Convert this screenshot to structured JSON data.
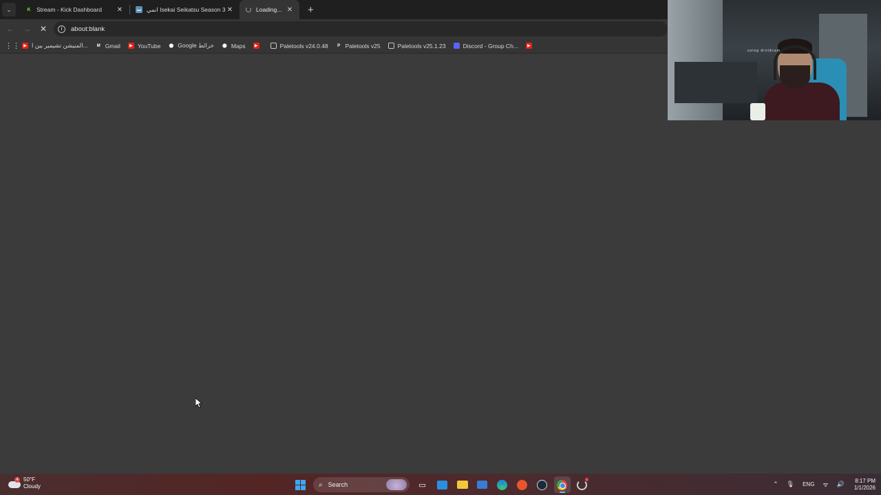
{
  "browser": {
    "tab_search_glyph": "⌄",
    "tabs": [
      {
        "title": "Stream - Kick Dashboard",
        "favicon": "kick-icon"
      },
      {
        "title": "انمي Isekai Seikatsu Season 3 ...",
        "favicon": "anime-site-icon"
      },
      {
        "title": "Loading...",
        "favicon": "loading-spinner-icon"
      }
    ],
    "close_glyph": "✕",
    "new_tab_glyph": "+",
    "back_glyph": "←",
    "forward_glyph": "→",
    "stop_glyph": "✕",
    "info_glyph": "i",
    "address": "about:blank",
    "apps_glyph": "⋮⋮",
    "bookmarks": [
      {
        "label": "المنيشن تشيمير بين ا...",
        "icon": "youtube-icon"
      },
      {
        "label": "Gmail",
        "icon": "gmail-icon"
      },
      {
        "label": "YouTube",
        "icon": "youtube-icon"
      },
      {
        "label": "Google خرائط",
        "icon": "maps-icon"
      },
      {
        "label": "Maps",
        "icon": "maps-icon"
      },
      {
        "label": "",
        "icon": "youtube-icon"
      },
      {
        "label": "Paletools v24.0.48",
        "icon": "globe-icon"
      },
      {
        "label": "Paletools v25",
        "icon": "paletools-icon"
      },
      {
        "label": "Paletools v25.1.23",
        "icon": "globe-icon"
      },
      {
        "label": "Discord - Group Ch...",
        "icon": "discord-icon"
      },
      {
        "label": "",
        "icon": "youtube-icon"
      }
    ]
  },
  "webcam": {
    "overlay_text": "using droidcam"
  },
  "taskbar": {
    "weather": {
      "temp": "50°F",
      "condition": "Cloudy",
      "badge": "4"
    },
    "search_glyph": "⌕",
    "search_placeholder": "Search",
    "taskview_glyph": "▭",
    "tray": {
      "chevron": "⌃",
      "mic": "🎙",
      "language": "ENG",
      "wifi": "ᯤ",
      "volume": "🔊",
      "time": "8:17 PM",
      "date": "1/1/2026"
    }
  },
  "colors": {
    "page_bg": "#3b3b3b",
    "toolbar_bg": "#353535",
    "tabstrip_bg": "#1f1f1f"
  }
}
